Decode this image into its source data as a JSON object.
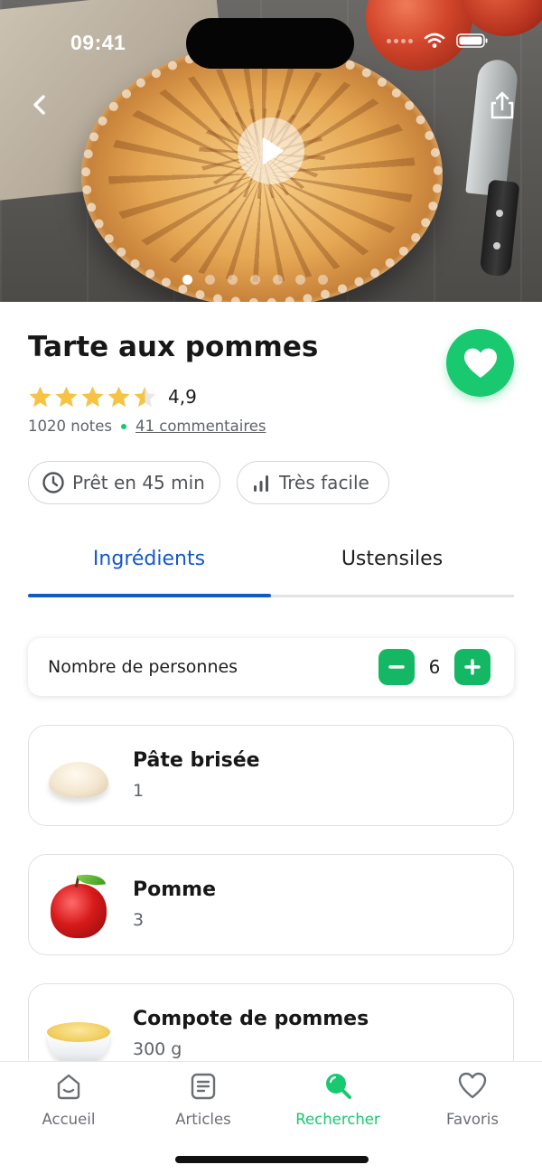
{
  "status_bar": {
    "time": "09:41"
  },
  "recipe": {
    "title": "Tarte aux pommes",
    "rating": "4,9",
    "rating_value": 4.5,
    "ratings_count": "1020 notes",
    "comments": "41 commentaires",
    "time_chip": "Prêt en 45 min",
    "difficulty_chip": "Très facile"
  },
  "gallery": {
    "slides": 7,
    "active_slide": 1
  },
  "tabs": [
    {
      "label": "Ingrédients",
      "active": true
    },
    {
      "label": "Ustensiles",
      "active": false
    }
  ],
  "servings": {
    "label": "Nombre de personnes",
    "count": "6"
  },
  "ingredients": [
    {
      "name": "Pâte brisée",
      "qty": "1",
      "icon": "dough-image"
    },
    {
      "name": "Pomme",
      "qty": "3",
      "icon": "apple-image"
    },
    {
      "name": "Compote de pommes",
      "qty": "300 g",
      "icon": "applesauce-image"
    }
  ],
  "bottom_nav": [
    {
      "label": "Accueil",
      "icon": "home-icon",
      "active": false
    },
    {
      "label": "Articles",
      "icon": "articles-icon",
      "active": false
    },
    {
      "label": "Rechercher",
      "icon": "search-icon",
      "active": true
    },
    {
      "label": "Favoris",
      "icon": "heart-icon",
      "active": false
    }
  ],
  "colors": {
    "accent_green": "#18c970",
    "tab_blue": "#1459c8",
    "star_yellow": "#f6c344"
  }
}
